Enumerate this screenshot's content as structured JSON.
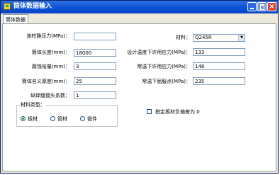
{
  "window": {
    "title": "筒体数据输入"
  },
  "tabs": [
    {
      "label": "筒体数据"
    }
  ],
  "form": {
    "liquid_pressure_label": "液柱静压力(MPa)：",
    "liquid_pressure_value": "",
    "shell_length_label": "筒体长度(mm)：",
    "shell_length_value": "18000",
    "corrosion_allowance_label": "腐蚀裕量(mm)：",
    "corrosion_allowance_value": "3",
    "nominal_thickness_label": "筒体名义厚度(mm)：",
    "nominal_thickness_value": "25",
    "weld_joint_factor_label": "纵焊缝接头系数：",
    "weld_joint_factor_value": "1",
    "material_label": "材料：",
    "material_value": "Q245R",
    "design_temp_stress_label": "设计温度下许用应力(MPa)：",
    "design_temp_stress_value": "133",
    "room_temp_stress_label": "常温下许用应力(MPa)：",
    "room_temp_stress_value": "148",
    "room_temp_yield_label": "常温下屈服点(MPa)：",
    "room_temp_yield_value": "235"
  },
  "material_type": {
    "title": "材料类型：",
    "options": [
      {
        "label": "板材",
        "selected": true
      },
      {
        "label": "管材",
        "selected": false
      },
      {
        "label": "锻件",
        "selected": false
      }
    ]
  },
  "checkbox": {
    "label": "指定板材负偏差为 0",
    "checked": false
  },
  "icons": {
    "app": "app-icon",
    "minimize": "minimize-icon",
    "maximize": "maximize-icon",
    "close": "close-icon",
    "dropdown": "chevron-down-icon"
  },
  "colors": {
    "titlebar": "#0a4fd4",
    "close_button": "#d9462c",
    "window_bg": "#ece9d8",
    "panel_bg": "#ffffff",
    "field_border": "#7f9db9",
    "radio_dot": "#21a121"
  }
}
